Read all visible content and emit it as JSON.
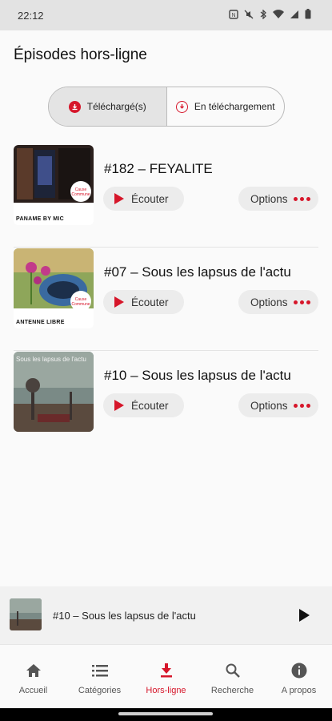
{
  "status_bar": {
    "time": "22:12"
  },
  "header": {
    "title": "Épisodes hors-ligne"
  },
  "tabs": [
    {
      "label": "Téléchargé(s)",
      "active": true
    },
    {
      "label": "En téléchargement",
      "active": false
    }
  ],
  "episodes": [
    {
      "title": "#182 – FEYALITE",
      "show_label": "PANAME BY MIC",
      "listen_label": "Écouter",
      "options_label": "Options"
    },
    {
      "title": "#07 – Sous les lapsus de l'actu",
      "show_label": "ANTENNE LIBRE",
      "listen_label": "Écouter",
      "options_label": "Options"
    },
    {
      "title": "#10 – Sous les lapsus de l'actu",
      "show_label": "",
      "thumb_text": "Sous les lapsus de l'actu",
      "listen_label": "Écouter",
      "options_label": "Options"
    }
  ],
  "mini_player": {
    "title": "#10 – Sous les lapsus de l'actu"
  },
  "nav": [
    {
      "label": "Accueil",
      "icon": "home-icon",
      "active": false
    },
    {
      "label": "Catégories",
      "icon": "list-icon",
      "active": false
    },
    {
      "label": "Hors-ligne",
      "icon": "download-icon",
      "active": true
    },
    {
      "label": "Recherche",
      "icon": "search-icon",
      "active": false
    },
    {
      "label": "A propos",
      "icon": "info-icon",
      "active": false
    }
  ],
  "colors": {
    "accent": "#d6162a",
    "background": "#fafafa",
    "pill": "#ececec"
  }
}
